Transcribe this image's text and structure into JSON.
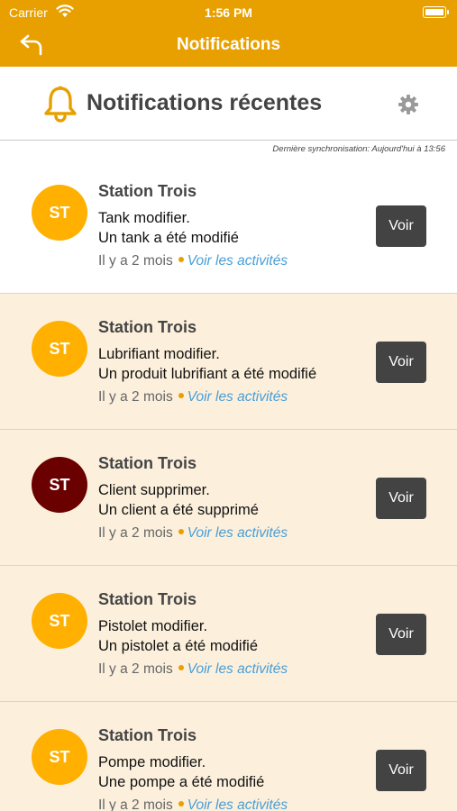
{
  "status_bar": {
    "carrier": "Carrier",
    "time": "1:56 PM"
  },
  "nav": {
    "title": "Notifications",
    "back_icon": "back-arrow-icon"
  },
  "header": {
    "title": "Notifications récentes",
    "bell_icon": "bell-icon",
    "settings_icon": "gear-icon"
  },
  "sync_text": "Dernière synchronisation: Aujourd'hui à 13:56",
  "colors": {
    "brand": "#e8a000",
    "unread_bg": "#fcf0dc",
    "avatar_orange": "#ffb000",
    "avatar_dark": "#6b0000",
    "link": "#4a9ed6",
    "button": "#434343"
  },
  "notifications": [
    {
      "initials": "ST",
      "station": "Station Trois",
      "line1": "Tank modifier.",
      "line2": "Un tank a été modifié",
      "time": "Il y a 2 mois",
      "link": "Voir les activités",
      "button": "Voir",
      "state": "read",
      "avatar_color": "#ffb000"
    },
    {
      "initials": "ST",
      "station": "Station Trois",
      "line1": "Lubrifiant modifier.",
      "line2": "Un produit lubrifiant a été modifié",
      "time": "Il y a 2 mois",
      "link": "Voir les activités",
      "button": "Voir",
      "state": "unread",
      "avatar_color": "#ffb000"
    },
    {
      "initials": "ST",
      "station": "Station Trois",
      "line1": "Client supprimer.",
      "line2": "Un client a été supprimé",
      "time": "Il y a 2 mois",
      "link": "Voir les activités",
      "button": "Voir",
      "state": "unread",
      "avatar_color": "#6b0000"
    },
    {
      "initials": "ST",
      "station": "Station Trois",
      "line1": "Pistolet modifier.",
      "line2": "Un pistolet a été modifié",
      "time": "Il y a 2 mois",
      "link": "Voir les activités",
      "button": "Voir",
      "state": "unread",
      "avatar_color": "#ffb000"
    },
    {
      "initials": "ST",
      "station": "Station Trois",
      "line1": "Pompe modifier.",
      "line2": "Une pompe a été modifié",
      "time": "Il y a 2 mois",
      "link": "Voir les activités",
      "button": "Voir",
      "state": "unread",
      "avatar_color": "#ffb000"
    }
  ]
}
